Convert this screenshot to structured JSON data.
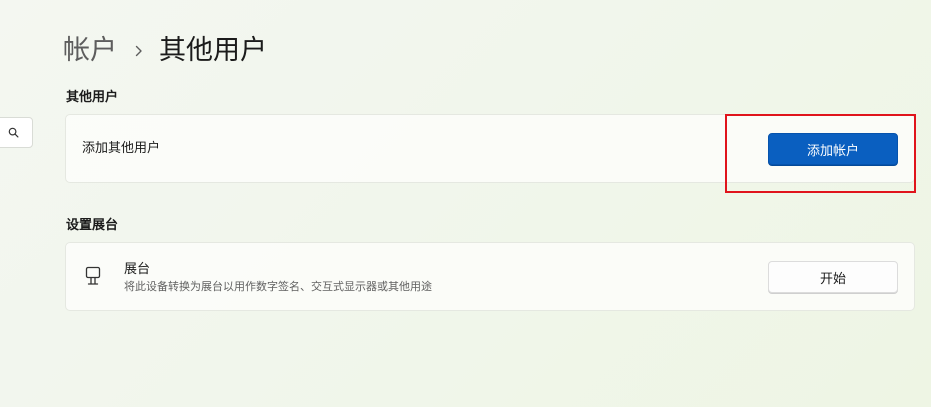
{
  "breadcrumb": {
    "parent": "帐户",
    "current": "其他用户"
  },
  "other_users": {
    "section_title": "其他用户",
    "add_label": "添加其他用户",
    "add_button": "添加帐户"
  },
  "kiosk": {
    "section_title": "设置展台",
    "title": "展台",
    "description": "将此设备转换为展台以用作数字签名、交互式显示器或其他用途",
    "start_button": "开始"
  },
  "icons": {
    "search": "search-icon",
    "chevron": "chevron-right-icon",
    "kiosk": "kiosk-icon"
  },
  "colors": {
    "accent": "#0a5fc0",
    "highlight": "#e0141c"
  }
}
